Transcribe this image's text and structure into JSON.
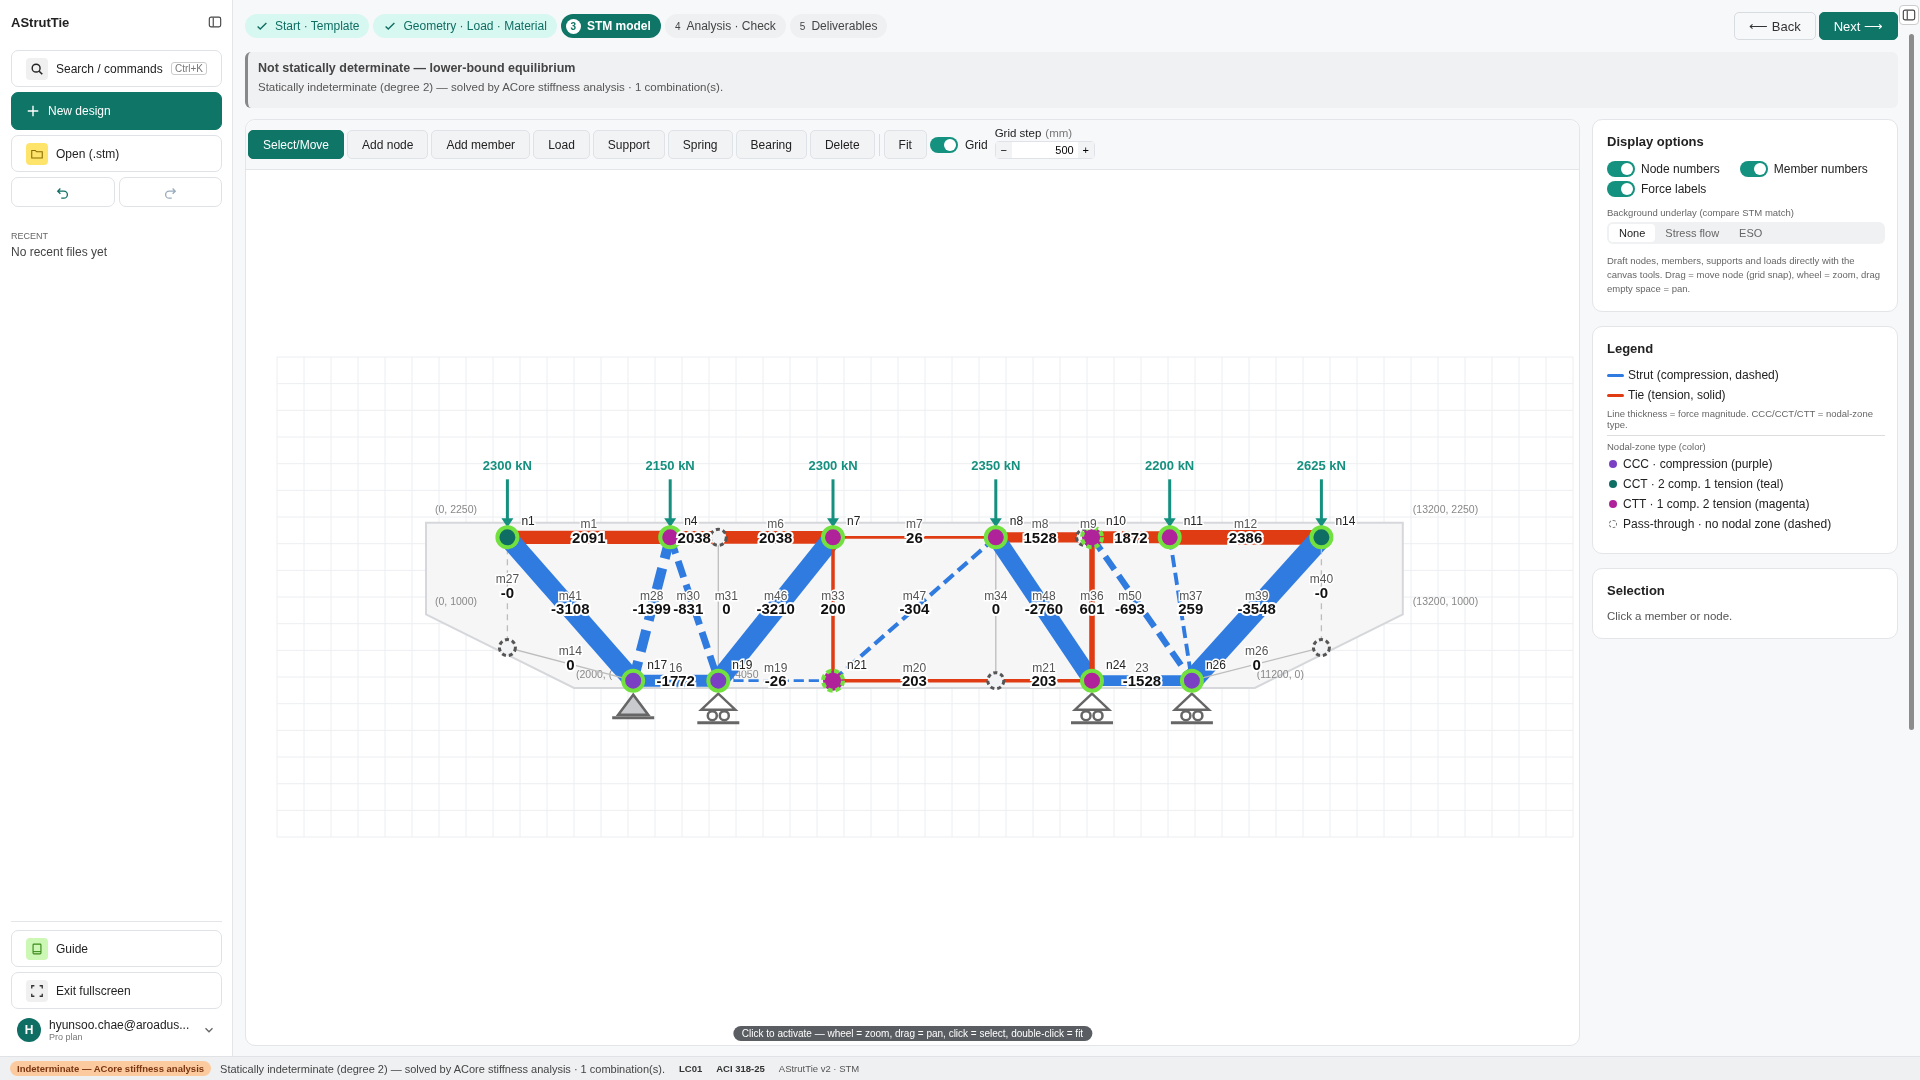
{
  "app": {
    "title": "AStrutTie"
  },
  "sidebar": {
    "search": {
      "label": "Search / commands",
      "shortcut": "Ctrl+K"
    },
    "new_button": "New design",
    "open_button": "Open (.stm)",
    "recent_heading": "RECENT",
    "recent_empty": "No recent files yet",
    "guide_button": "Guide",
    "fullscreen_button": "Exit fullscreen",
    "user": {
      "initial": "H",
      "email": "hyunsoo.chae@aroadus...",
      "plan": "Pro plan"
    }
  },
  "steps": [
    {
      "label": "Start · Template",
      "done": true,
      "selected": false
    },
    {
      "label": "Geometry · Load · Material",
      "done": true,
      "selected": false
    },
    {
      "number": "3",
      "label": "STM model",
      "done": false,
      "selected": true
    },
    {
      "number": "4",
      "label": "Analysis · Check",
      "done": false,
      "selected": false
    },
    {
      "number": "5",
      "label": "Deliverables",
      "done": false,
      "selected": false
    }
  ],
  "nav": {
    "back": "⟵ Back",
    "next": "Next ⟶"
  },
  "banner": {
    "title": "Not statically determinate — lower-bound equilibrium",
    "text": "Statically indeterminate (degree 2) — solved by ACore stiffness analysis · 1 combination(s)."
  },
  "toolbar": {
    "tools": [
      {
        "label": "Select/Move",
        "selected": true
      },
      {
        "label": "Add node",
        "selected": false
      },
      {
        "label": "Add member",
        "selected": false
      },
      {
        "label": "Load",
        "selected": false
      },
      {
        "label": "Support",
        "selected": false
      },
      {
        "label": "Spring",
        "selected": false
      },
      {
        "label": "Bearing",
        "selected": false
      },
      {
        "label": "Delete",
        "selected": false
      }
    ],
    "fit": "Fit",
    "grid": {
      "label": "Grid",
      "on": true
    },
    "grid_step": {
      "label": "Grid step",
      "unit": "(mm)",
      "value": "500",
      "minus": "−",
      "plus": "+"
    }
  },
  "canvas": {
    "region_labels": [
      {
        "text": "(0, 2250)"
      },
      {
        "text": "(0, 1000)"
      },
      {
        "text": "(2000, ("
      },
      {
        "text": "(4050"
      },
      {
        "text": "(11200, 0)"
      },
      {
        "text": "(13200, 1000)"
      },
      {
        "text": "(13200, 2250)"
      }
    ],
    "nodes": [
      {
        "label": "n1",
        "kind": "cct",
        "flagged": false
      },
      {
        "label": "n4",
        "kind": "ctt",
        "flagged": false
      },
      {
        "kind": "pass"
      },
      {
        "label": "n7",
        "kind": "ctt",
        "flagged": false
      },
      {
        "label": "n8",
        "kind": "ctt",
        "flagged": false
      },
      {
        "kind": "pass"
      },
      {
        "label": "n10",
        "kind": "ctt",
        "flagged": true
      },
      {
        "label": "n11",
        "kind": "ctt",
        "flagged": false
      },
      {
        "label": "n14",
        "kind": "cct",
        "flagged": false
      },
      {
        "kind": "pass"
      },
      {
        "label": "n17",
        "kind": "ccc",
        "flagged": false
      },
      {
        "label": "n19",
        "kind": "ccc",
        "flagged": false
      },
      {
        "label": "n21",
        "kind": "ctt",
        "flagged": true
      },
      {
        "kind": "pass"
      },
      {
        "label": "n24",
        "kind": "ctt",
        "flagged": false
      },
      {
        "label": "n26",
        "kind": "ccc",
        "flagged": false
      },
      {
        "kind": "pass"
      }
    ],
    "members": [
      {
        "label": "m1",
        "kind": "tie",
        "force": "2091"
      },
      {
        "kind": "tie",
        "force": "2038"
      },
      {
        "label": "m6",
        "kind": "tie",
        "force": "2038"
      },
      {
        "label": "m7",
        "kind": "tie",
        "force": "26"
      },
      {
        "label": "m8",
        "kind": "tie",
        "force": "1528"
      },
      {
        "label": "m9",
        "kind": "tie"
      },
      {
        "kind": "tie",
        "force": "1872"
      },
      {
        "label": "m12",
        "kind": "tie",
        "force": "2386"
      },
      {
        "label": "m27",
        "kind": "zero_dashed",
        "force": "-0"
      },
      {
        "label": "m41",
        "kind": "strut",
        "force": "-3108"
      },
      {
        "label": "m28",
        "kind": "strut",
        "force": "-1399"
      },
      {
        "label": "m30",
        "kind": "strut",
        "force": "-831"
      },
      {
        "label": "m31",
        "kind": "zero",
        "force": "0"
      },
      {
        "label": "m46",
        "kind": "strut",
        "force": "-3210"
      },
      {
        "label": "m33",
        "kind": "tie",
        "force": "200"
      },
      {
        "label": "m47",
        "kind": "strut",
        "force": "-304"
      },
      {
        "label": "m34",
        "kind": "zero",
        "force": "0"
      },
      {
        "label": "m48",
        "kind": "strut",
        "force": "-2760"
      },
      {
        "label": "m36",
        "kind": "tie",
        "force": "601"
      },
      {
        "label": "m50",
        "kind": "strut",
        "force": "-693"
      },
      {
        "label": "m37",
        "kind": "strut",
        "force": "259"
      },
      {
        "label": "m39",
        "kind": "strut",
        "force": "-3548"
      },
      {
        "label": "m40",
        "kind": "zero_dashed",
        "force": "-0"
      },
      {
        "label": "m14",
        "kind": "zero",
        "force": "0"
      },
      {
        "label": "16",
        "kind": "strut",
        "force": "-1772"
      },
      {
        "label": "m19",
        "kind": "strut",
        "force": "-26"
      },
      {
        "label": "m20",
        "kind": "tie",
        "force": "203"
      },
      {
        "label": "m21",
        "kind": "tie",
        "force": "203"
      },
      {
        "label": "23",
        "kind": "strut",
        "force": "-1528"
      },
      {
        "label": "m26",
        "kind": "zero",
        "force": "0"
      }
    ],
    "loads": [
      {
        "label": "2300 kN"
      },
      {
        "label": "2150 kN"
      },
      {
        "label": "2300 kN"
      },
      {
        "label": "2350 kN"
      },
      {
        "label": "2200 kN"
      },
      {
        "label": "2625 kN"
      }
    ],
    "supports": [
      {
        "kind": "pin"
      },
      {
        "kind": "roller"
      },
      {
        "kind": "roller"
      },
      {
        "kind": "roller"
      }
    ],
    "hint": "Click to activate — wheel = zoom, drag = pan, click = select, double-click = fit"
  },
  "display_options": {
    "title": "Display options",
    "toggles": [
      {
        "label": "Node numbers",
        "on": true
      },
      {
        "label": "Member numbers",
        "on": true
      },
      {
        "label": "Force labels",
        "on": true
      }
    ],
    "underlay_label": "Background underlay (compare STM match)",
    "underlay_options": [
      {
        "label": "None",
        "selected": true
      },
      {
        "label": "Stress flow",
        "selected": false
      },
      {
        "label": "ESO",
        "selected": false
      }
    ],
    "note": "Draft nodes, members, supports and loads directly with the canvas tools. Drag = move node (grid snap), wheel = zoom, drag empty space = pan."
  },
  "legend": {
    "title": "Legend",
    "lines": [
      {
        "label": "Strut (compression, dashed)",
        "color": "#2f7be0"
      },
      {
        "label": "Tie (tension, solid)",
        "color": "#e03c14"
      }
    ],
    "note": "Line thickness = force magnitude. CCC/CCT/CTT = nodal-zone type.",
    "zone_heading": "Nodal-zone type (color)",
    "zones": [
      {
        "kind": "dot",
        "label": "CCC · compression (purple)",
        "color": "#7b3fc4"
      },
      {
        "kind": "dot",
        "label": "CCT · 2 comp. 1 tension (teal)",
        "color": "#0f6e63"
      },
      {
        "kind": "dot",
        "label": "CTT · 1 comp. 2 tension (magenta)",
        "color": "#b0229a"
      },
      {
        "kind": "dashed",
        "label": "Pass-through · no nodal zone (dashed)"
      }
    ]
  },
  "selection": {
    "title": "Selection",
    "text": "Click a member or node."
  },
  "status_bar": {
    "badge": "Indeterminate — ACore stiffness analysis",
    "text": "Statically indeterminate (degree 2) — solved by ACore stiffness analysis · 1 combination(s).",
    "load_case": "LC01",
    "code": "ACI 318-25",
    "version": "AStrutTie v2 · STM"
  }
}
